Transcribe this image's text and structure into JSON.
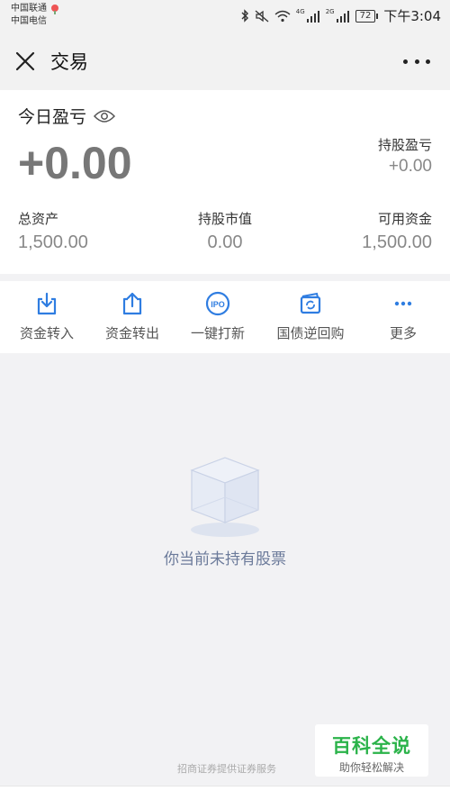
{
  "status_bar": {
    "carrier_1": "中国联通",
    "carrier_2": "中国电信",
    "net_1": "4G",
    "net_2": "2G",
    "battery": "72",
    "time": "下午3:04"
  },
  "header": {
    "title": "交易",
    "close_icon": "close-icon",
    "more_icon": "more-dots-icon"
  },
  "summary": {
    "today_pl_label": "今日盈亏",
    "today_pl_value": "+0.00",
    "holding_pl_label": "持股盈亏",
    "holding_pl_value": "+0.00",
    "stats": [
      {
        "label": "总资产",
        "value": "1,500.00"
      },
      {
        "label": "持股市值",
        "value": "0.00"
      },
      {
        "label": "可用资金",
        "value": "1,500.00"
      }
    ]
  },
  "actions": [
    {
      "label": "资金转入",
      "icon": "transfer-in-icon"
    },
    {
      "label": "资金转出",
      "icon": "transfer-out-icon"
    },
    {
      "label": "一键打新",
      "icon": "ipo-icon"
    },
    {
      "label": "国债逆回购",
      "icon": "repo-icon"
    },
    {
      "label": "更多",
      "icon": "more-icon"
    }
  ],
  "empty_state": {
    "text": "你当前未持有股票",
    "icon": "empty-box-icon"
  },
  "footer": {
    "note": "招商证券提供证券服务"
  },
  "watermark": {
    "title": "百科全说",
    "subtitle": "助你轻松解决"
  },
  "colors": {
    "accent": "#2f7de1",
    "watermark_green": "#2bb34a"
  }
}
